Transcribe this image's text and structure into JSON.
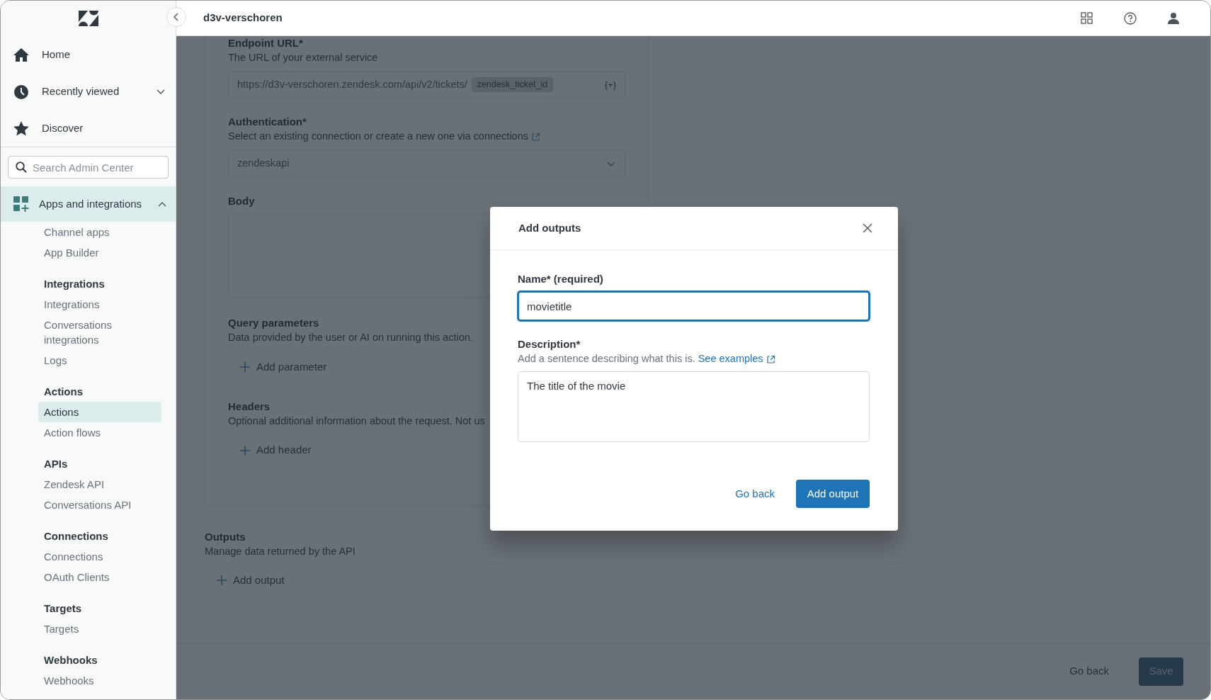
{
  "header": {
    "title": "d3v-verschoren"
  },
  "sidebar": {
    "nav": [
      {
        "label": "Home",
        "kind": "home"
      },
      {
        "label": "Recently viewed",
        "kind": "clock",
        "expanded": false
      },
      {
        "label": "Discover",
        "kind": "star"
      }
    ],
    "search": {
      "placeholder": "Search Admin Center"
    },
    "section": {
      "label": "Apps and integrations",
      "expanded": true,
      "selected": true,
      "groups": [
        {
          "items": [
            {
              "label": "Channel apps",
              "selected": false
            },
            {
              "label": "App Builder",
              "selected": false
            }
          ]
        },
        {
          "title": "Integrations",
          "items": [
            {
              "label": "Integrations",
              "selected": false
            },
            {
              "label": "Conversations integrations",
              "selected": false
            },
            {
              "label": "Logs",
              "selected": false
            }
          ]
        },
        {
          "title": "Actions",
          "items": [
            {
              "label": "Actions",
              "selected": true
            },
            {
              "label": "Action flows",
              "selected": false
            }
          ]
        },
        {
          "title": "APIs",
          "items": [
            {
              "label": "Zendesk API",
              "selected": false
            },
            {
              "label": "Conversations API",
              "selected": false
            }
          ]
        },
        {
          "title": "Connections",
          "items": [
            {
              "label": "Connections",
              "selected": false
            },
            {
              "label": "OAuth Clients",
              "selected": false
            }
          ]
        },
        {
          "title": "Targets",
          "items": [
            {
              "label": "Targets",
              "selected": false
            }
          ]
        },
        {
          "title": "Webhooks",
          "items": [
            {
              "label": "Webhooks",
              "selected": false
            }
          ]
        }
      ]
    }
  },
  "form": {
    "fields": [
      {
        "kind": "url",
        "label": "Endpoint URL*",
        "hint": "The URL of your external service",
        "value": "https://d3v-verschoren.zendesk.com/api/v2/tickets/",
        "token": "zendesk_ticket_id",
        "insert": "{+}"
      },
      {
        "kind": "select",
        "label": "Authentication*",
        "hint": "Select an existing connection or create a new one via ",
        "link": "connections",
        "value": "zendeskapi"
      },
      {
        "kind": "textarea",
        "label": "Body"
      },
      {
        "kind": "list",
        "label": "Query parameters",
        "hint": "Data provided by the user or AI on running this action.",
        "action": "Add parameter"
      },
      {
        "kind": "list",
        "label": "Headers",
        "hint": "Optional additional information about the request. Not us",
        "action": "Add header"
      }
    ]
  },
  "outputs": {
    "label": "Outputs",
    "hint": "Manage data returned by the API",
    "action": "Add output"
  },
  "footer": {
    "back": "Go back",
    "save": "Save"
  },
  "modal": {
    "title": "Add outputs",
    "name_label": "Name* (required)",
    "name_value": "movietitle",
    "description_label": "Description*",
    "description_hint": "Add a sentence describing what this is. ",
    "hint_link": "See examples",
    "description_value": "The title of the movie",
    "secondary": "Go back",
    "primary": "Add output"
  }
}
